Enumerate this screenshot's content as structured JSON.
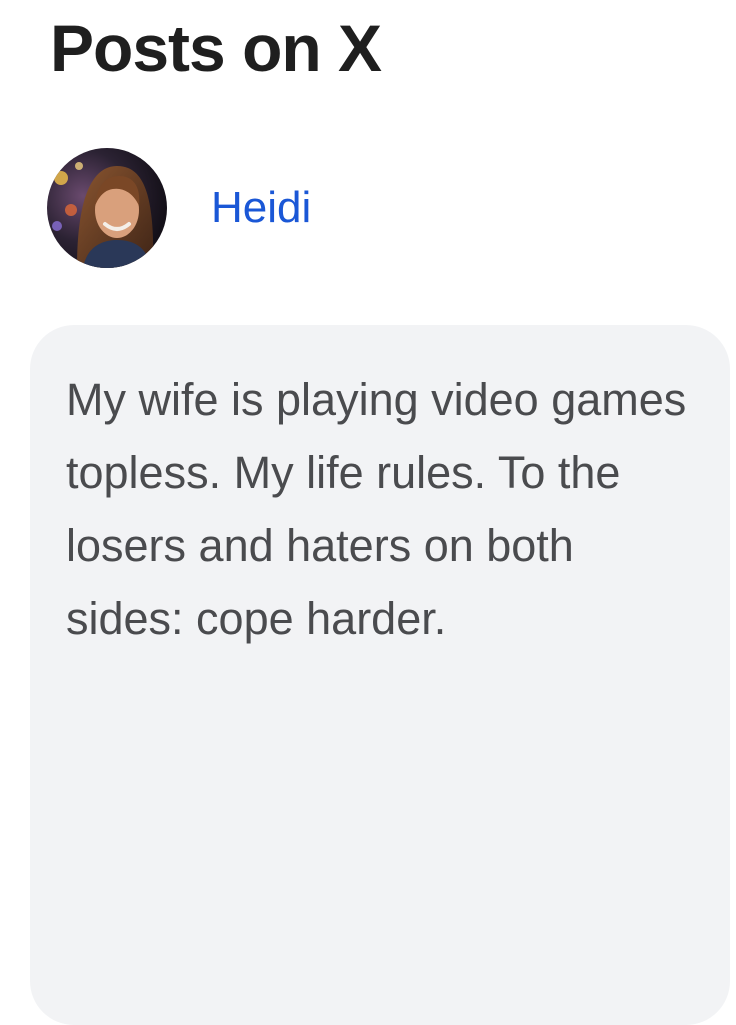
{
  "section": {
    "title": "Posts on X"
  },
  "post": {
    "author_name": "Heidi",
    "text": "My wife is playing video games topless. My life rules. To the losers and haters on both sides: cope harder."
  },
  "icons": {
    "avatar": "person-photo-avatar"
  },
  "colors": {
    "author_link": "#1a57d6",
    "card_background": "#f2f3f5",
    "post_text": "#4a4b4e",
    "title_text": "#1f1f1f"
  }
}
